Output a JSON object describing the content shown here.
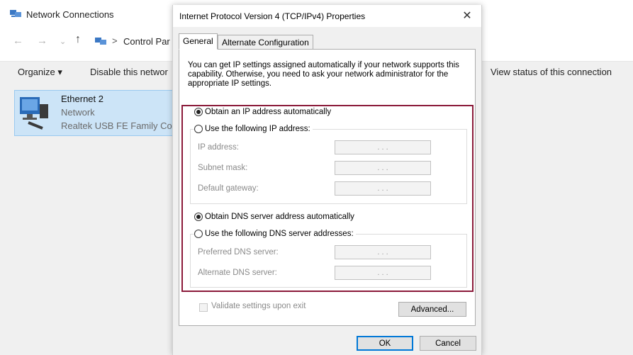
{
  "explorer": {
    "title": "Network Connections",
    "breadcrumb_sep": ">",
    "address_text": "Control Par",
    "toolbar": {
      "organize": "Organize ▾",
      "disable": "Disable this networ",
      "view_status": "View status of this connection"
    },
    "connection": {
      "name": "Ethernet 2",
      "network": "Network",
      "device": "Realtek USB FE Family Co"
    }
  },
  "dialog": {
    "title": "Internet Protocol Version 4 (TCP/IPv4) Properties",
    "close_glyph": "✕",
    "tabs": [
      "General",
      "Alternate Configuration"
    ],
    "intro": "You can get IP settings assigned automatically if your network supports this capability. Otherwise, you need to ask your network administrator for the appropriate IP settings.",
    "ip": {
      "auto_label": "Obtain an IP address automatically",
      "manual_label": "Use the following IP address:",
      "auto_selected": true,
      "fields": [
        {
          "label": "IP address:",
          "value": ".   .   ."
        },
        {
          "label": "Subnet mask:",
          "value": ".   .   ."
        },
        {
          "label": "Default gateway:",
          "value": ".   .   ."
        }
      ]
    },
    "dns": {
      "auto_label": "Obtain DNS server address automatically",
      "manual_label": "Use the following DNS server addresses:",
      "auto_selected": true,
      "fields": [
        {
          "label": "Preferred DNS server:",
          "value": ".   .   ."
        },
        {
          "label": "Alternate DNS server:",
          "value": ".   .   ."
        }
      ]
    },
    "validate_label": "Validate settings upon exit",
    "advanced_label": "Advanced...",
    "ok_label": "OK",
    "cancel_label": "Cancel"
  },
  "colors": {
    "highlight_border": "#8b1a3a",
    "selection_bg": "#cce4f7",
    "default_button_border": "#0078d7"
  }
}
